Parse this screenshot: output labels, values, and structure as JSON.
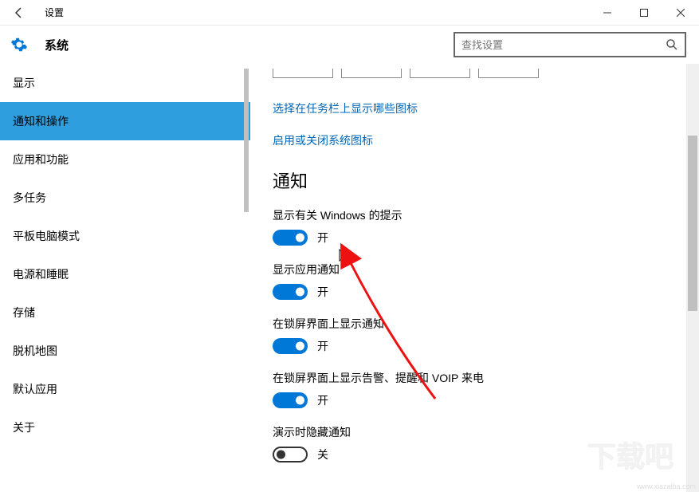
{
  "window": {
    "title": "设置"
  },
  "header": {
    "category": "系统"
  },
  "search": {
    "placeholder": "查找设置"
  },
  "sidebar": {
    "items": [
      {
        "label": "显示"
      },
      {
        "label": "通知和操作"
      },
      {
        "label": "应用和功能"
      },
      {
        "label": "多任务"
      },
      {
        "label": "平板电脑模式"
      },
      {
        "label": "电源和睡眠"
      },
      {
        "label": "存储"
      },
      {
        "label": "脱机地图"
      },
      {
        "label": "默认应用"
      },
      {
        "label": "关于"
      }
    ],
    "active_index": 1
  },
  "content": {
    "links": [
      "选择在任务栏上显示哪些图标",
      "启用或关闭系统图标"
    ],
    "section_title": "通知",
    "settings": [
      {
        "label": "显示有关 Windows 的提示",
        "on": true,
        "state": "开"
      },
      {
        "label": "显示应用通知",
        "on": true,
        "state": "开"
      },
      {
        "label": "在锁屏界面上显示通知",
        "on": true,
        "state": "开"
      },
      {
        "label": "在锁屏界面上显示告警、提醒和 VOIP 来电",
        "on": true,
        "state": "开"
      },
      {
        "label": "演示时隐藏通知",
        "on": false,
        "state": "关"
      }
    ]
  },
  "watermark": "www.xiazaiba.com"
}
